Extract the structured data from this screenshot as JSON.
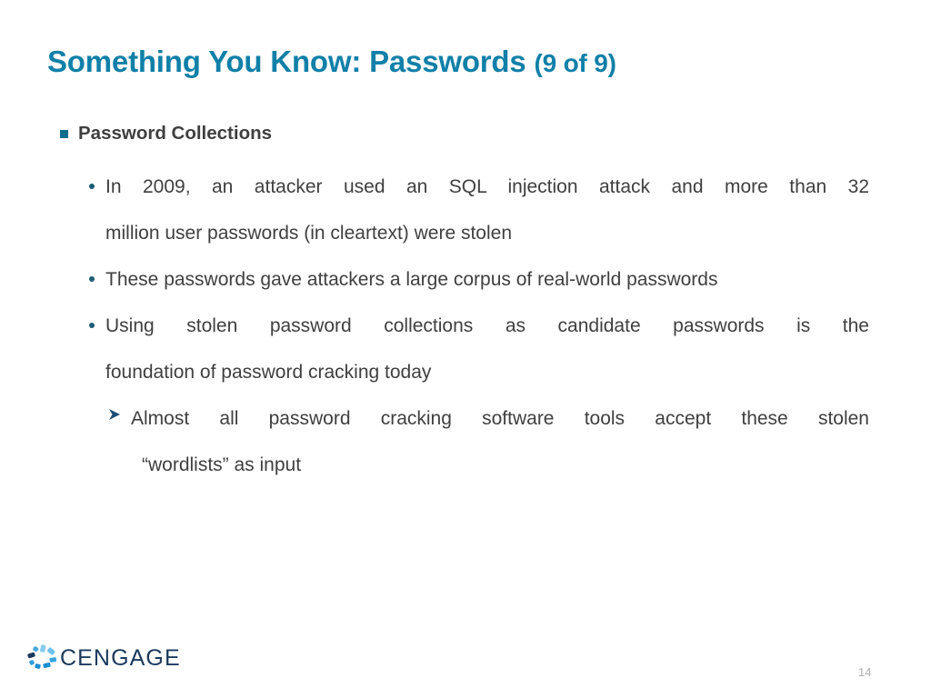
{
  "slide": {
    "title_main": "Something You Know: Passwords ",
    "title_suffix": "(9 of 9)",
    "page_number": "14",
    "colors": {
      "title": "#1180a8",
      "body_text": "#3f3f3f",
      "marker_square": "#106e8c",
      "marker_dot": "#1a5d74",
      "marker_arrow": "#1f4d73",
      "logo_word": "#1b3a5c",
      "page_number": "#b0b0b0",
      "background": "#ffffff"
    },
    "bullets": {
      "heading": "Password Collections",
      "item1_line1": "In 2009, an attacker used an SQL injection attack and more than 32",
      "item1_line2": "million user passwords (in cleartext) were stolen",
      "item2_line1": "These passwords gave attackers a large corpus of real-world passwords",
      "item3_line1": "Using stolen password collections as candidate passwords is the",
      "item3_line2": "foundation of password cracking today",
      "item4_line1": "Almost all password cracking software tools accept these stolen",
      "item4_line2": "“wordlists” as input"
    }
  },
  "logo": {
    "wordmark": "CENGAGE",
    "mark_name": "cengage-swirl-mark"
  }
}
